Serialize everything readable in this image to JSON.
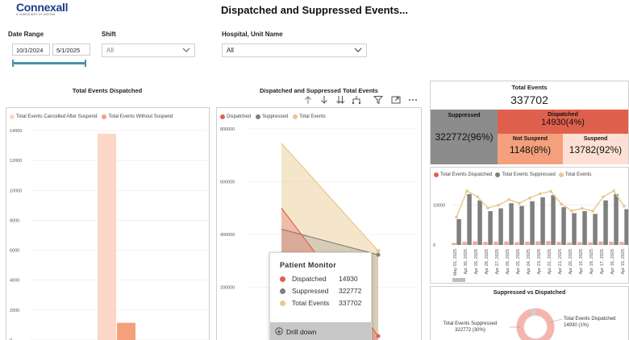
{
  "logo": {
    "name": "Connexall",
    "tagline": "A SUBSIDIARY OF ASCOM"
  },
  "title": "Dispatched and Suppressed Events...",
  "filters": {
    "date_range": {
      "label": "Date Range",
      "start": "10/1/2024",
      "end": "5/1/2025"
    },
    "shift": {
      "label": "Shift",
      "value": "All"
    },
    "hospital_unit": {
      "label": "Hospital, Unit Name",
      "value": "All"
    }
  },
  "colors": {
    "cancelled_after_suspend": "#fcd6c6",
    "without_suspend": "#f4a07d",
    "dispatched": "#e0604e",
    "suppressed": "#7f7f7f",
    "total": "#e8c88b",
    "matrix_suppressed": "#8c8c8c",
    "matrix_dispatched": "#e0604e",
    "matrix_not_suspend": "#f4a07d",
    "matrix_suspend": "#fde0d3",
    "donut_suppressed": "#f4b5ae",
    "donut_dispatched": "#cfcfcf"
  },
  "panel1": {
    "title": "Total Events Dispatched",
    "legend": [
      "Total Events Cancelled After Suspend",
      "Total Events Without Suspend"
    ]
  },
  "panel2": {
    "title": "Dispatched and Suppressed Total Events",
    "legend": [
      "Dispatched",
      "Suppressed",
      "Total Events"
    ]
  },
  "kpi": {
    "title": "Total Events",
    "value": "337702",
    "suppressed_label": "Suppressed",
    "suppressed_value": "322772(96%)",
    "dispatched_label": "Dispatched",
    "dispatched_value": "14930(4%)",
    "not_suspend_label": "Not Suspend",
    "not_suspend_value": "1148(8%)",
    "suspend_label": "Suspend",
    "suspend_value": "13782(92%)"
  },
  "panel4": {
    "legend": [
      "Total Events Dispatched",
      "Total Events Suppressed",
      "Total Events"
    ]
  },
  "panel5": {
    "title": "Suppressed  vs Dispatched",
    "left_label": "Total Events Suppressed",
    "left_value": "322772 (30%)",
    "right_label": "Total Events Dispatched",
    "right_value": "14930 (1%)"
  },
  "tooltip": {
    "title": "Patient Monitor",
    "rows": [
      {
        "label": "Dispatched",
        "value": "14930"
      },
      {
        "label": "Suppressed",
        "value": "322772"
      },
      {
        "label": "Total Events",
        "value": "337702"
      }
    ],
    "drill_label": "Drill down"
  },
  "chart_data": [
    {
      "type": "bar",
      "id": "total-events-dispatched",
      "title": "Total Events Dispatched",
      "ylim": [
        0,
        14000
      ],
      "yticks": [
        0,
        2000,
        4000,
        6000,
        8000,
        10000,
        12000,
        14000
      ],
      "series": [
        {
          "name": "Total Events Cancelled After Suspend",
          "values": [
            13782
          ]
        },
        {
          "name": "Total Events Without Suspend",
          "values": [
            1148
          ]
        }
      ]
    },
    {
      "type": "area",
      "id": "dispatched-suppressed-total",
      "title": "Dispatched and Suppressed Total Events",
      "ylim": [
        0,
        800000
      ],
      "yticks": [
        200000,
        400000,
        600000,
        800000
      ],
      "series": [
        {
          "name": "Total Events",
          "values": [
            745000,
            337702
          ]
        },
        {
          "name": "Suppressed",
          "values": [
            420000,
            322772
          ]
        },
        {
          "name": "Dispatched",
          "values": [
            500000,
            14930
          ]
        }
      ]
    },
    {
      "type": "bar",
      "id": "daily-events",
      "ylim": [
        0,
        15000
      ],
      "yticks": [
        0,
        10000
      ],
      "x": [
        "May 01, 2025",
        "Apr 30, 2025",
        "Apr 29, 2025",
        "Apr 28, 2025",
        "Apr 27, 2025",
        "Apr 26, 2025",
        "Apr 25, 2025",
        "Apr 24, 2025",
        "Apr 23, 2025",
        "Apr 22, 2025",
        "Apr 21, 2025",
        "Apr 20, 2025",
        "Apr 19, 2025",
        "Apr 18, 2025",
        "Apr 17, 2025",
        "Apr 16, 2025",
        "Apr 15, 2025"
      ],
      "series": [
        {
          "name": "Total Events Dispatched",
          "values": [
            500,
            800,
            900,
            750,
            800,
            850,
            700,
            800,
            900,
            950,
            750,
            600,
            700,
            650,
            850,
            800,
            750
          ]
        },
        {
          "name": "Total Events Suppressed",
          "values": [
            6500,
            12800,
            11200,
            8500,
            9200,
            10500,
            9800,
            11000,
            12000,
            12500,
            9500,
            8000,
            8500,
            7800,
            11200,
            12800,
            9000
          ]
        },
        {
          "name": "Total Events",
          "values": [
            7000,
            13600,
            12100,
            9300,
            10000,
            11400,
            10500,
            11800,
            12900,
            13500,
            10300,
            8600,
            9200,
            8500,
            12100,
            13600,
            9750
          ]
        }
      ]
    },
    {
      "type": "pie",
      "id": "suppressed-vs-dispatched",
      "title": "Suppressed  vs Dispatched",
      "categories": [
        "Total Events Suppressed",
        "Total Events Dispatched"
      ],
      "values": [
        322772,
        14930
      ]
    }
  ]
}
